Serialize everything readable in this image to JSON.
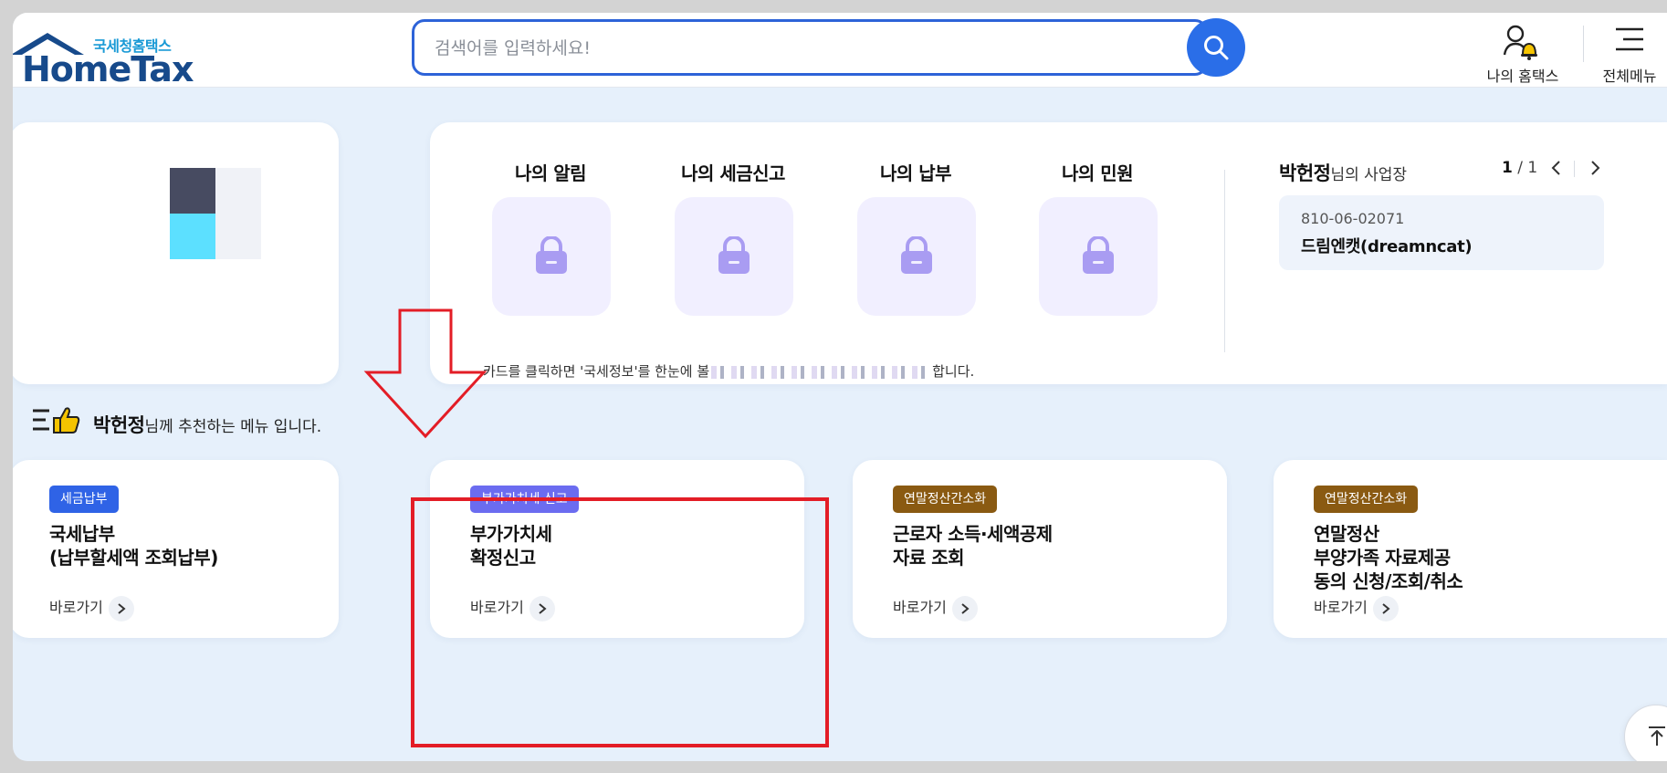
{
  "header": {
    "logo_kr": "국세청홈택스",
    "logo_en": "HomeTax",
    "search_placeholder": "검색어를 입력하세요!",
    "my_hometax": "나의 홈택스",
    "all_menu": "전체메뉴"
  },
  "dashboard": {
    "tiles": [
      {
        "label": "나의 알림",
        "icon": "lock-icon"
      },
      {
        "label": "나의 세금신고",
        "icon": "lock-icon"
      },
      {
        "label": "나의 납부",
        "icon": "lock-icon"
      },
      {
        "label": "나의 민원",
        "icon": "lock-icon"
      }
    ],
    "hint_start": "카드를 클릭하면 '국세정보'를 한눈에 볼",
    "hint_end": "합니다."
  },
  "business": {
    "name": "박헌정",
    "suffix": "님의 사업장",
    "page_current": "1",
    "page_total": "/ 1",
    "reg_number": "810-06-02071",
    "company": "드림엔캣(dreamncat)"
  },
  "recommend": {
    "name": "박헌정",
    "suffix": "님께 추천하는 메뉴 입니다."
  },
  "menu_cards": [
    {
      "badge": "세금납부",
      "badge_color": "#2f63e6",
      "title": "국세납부\n(납부할세액 조회납부)",
      "go": "바로가기"
    },
    {
      "badge": "부가가치세 신고",
      "badge_color": "#6b6cf0",
      "title": "부가가치세\n확정신고",
      "go": "바로가기"
    },
    {
      "badge": "연말정산간소화",
      "badge_color": "#8a5a12",
      "title": "근로자 소득·세액공제\n자료 조회",
      "go": "바로가기"
    },
    {
      "badge": "연말정산간소화",
      "badge_color": "#8a5a12",
      "title": "연말정산\n부양가족 자료제공\n동의 신청/조회/취소",
      "go": "바로가기"
    }
  ],
  "colors": {
    "accent": "#2a6ee8",
    "annotation": "#e31d26",
    "lock": "#a99cf2"
  }
}
